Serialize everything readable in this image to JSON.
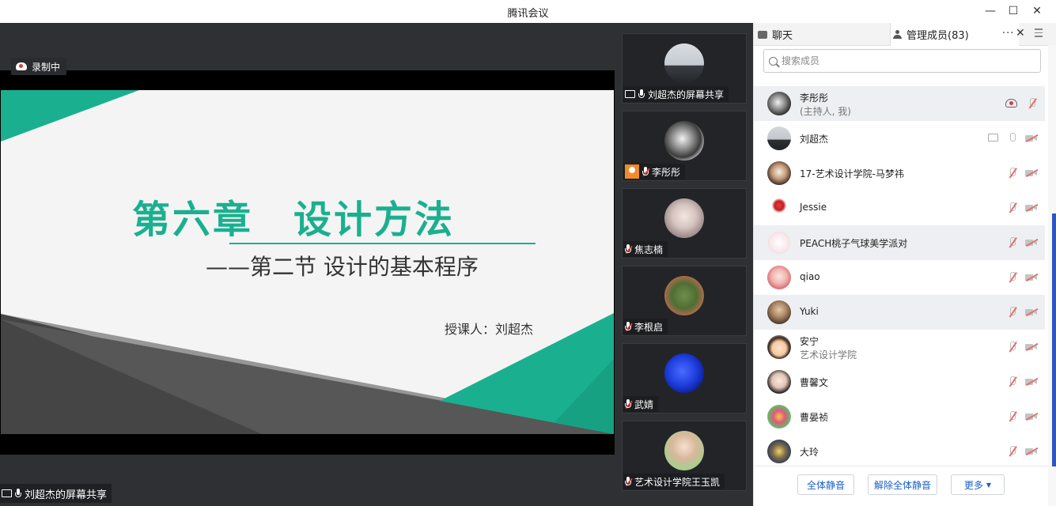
{
  "window": {
    "title": "腾讯会议",
    "min_glyph": "—",
    "max_glyph": "☐",
    "close_glyph": "✕"
  },
  "recording": {
    "label": "录制中"
  },
  "slide": {
    "title": "第六章　设计方法",
    "subtitle": "——第二节  设计的基本程序",
    "lecturer": "授课人：刘超杰",
    "accent_color": "#1ab08f"
  },
  "share_label": "刘超杰的屏幕共享",
  "thumbnails": [
    {
      "name": "刘超杰的屏幕共享",
      "mic": "on",
      "screen": true
    },
    {
      "name": "李彤彤",
      "mic": "muted",
      "host_badge": true
    },
    {
      "name": "焦志楠",
      "mic": "muted"
    },
    {
      "name": "李根启",
      "mic": "muted"
    },
    {
      "name": "武婧",
      "mic": "muted"
    },
    {
      "name": "艺术设计学院王玉凯",
      "mic": "muted"
    }
  ],
  "panel": {
    "tab_chat": "聊天",
    "tab_members": "管理成员(83)",
    "more_glyph": "···",
    "close_glyph": "✕",
    "search_placeholder": "搜索成员",
    "members": [
      {
        "name": "李彤彤",
        "sub": "(主持人, 我)",
        "recording": true,
        "mic": "muted",
        "cam": "none"
      },
      {
        "name": "刘超杰",
        "sub": "",
        "screen": true,
        "mic": "on",
        "cam": "off"
      },
      {
        "name": "17-艺术设计学院-马梦祎",
        "sub": "",
        "mic": "muted",
        "cam": "off"
      },
      {
        "name": "Jessie",
        "sub": "",
        "mic": "muted",
        "cam": "off"
      },
      {
        "name": "PEACH桃子气球美学派对",
        "sub": "",
        "mic": "muted",
        "cam": "off"
      },
      {
        "name": "qiao",
        "sub": "",
        "mic": "muted",
        "cam": "off"
      },
      {
        "name": "Yuki",
        "sub": "",
        "mic": "muted",
        "cam": "off"
      },
      {
        "name": "安宁",
        "sub": "艺术设计学院",
        "mic": "muted",
        "cam": "off"
      },
      {
        "name": "曹馨文",
        "sub": "",
        "mic": "muted",
        "cam": "off"
      },
      {
        "name": "曹晏祯",
        "sub": "",
        "mic": "muted",
        "cam": "off"
      },
      {
        "name": "大玲",
        "sub": "",
        "mic": "muted",
        "cam": "off"
      }
    ],
    "footer": {
      "mute_all": "全体静音",
      "unmute_all": "解除全体静音",
      "more": "更多",
      "more_caret": "▼"
    }
  }
}
